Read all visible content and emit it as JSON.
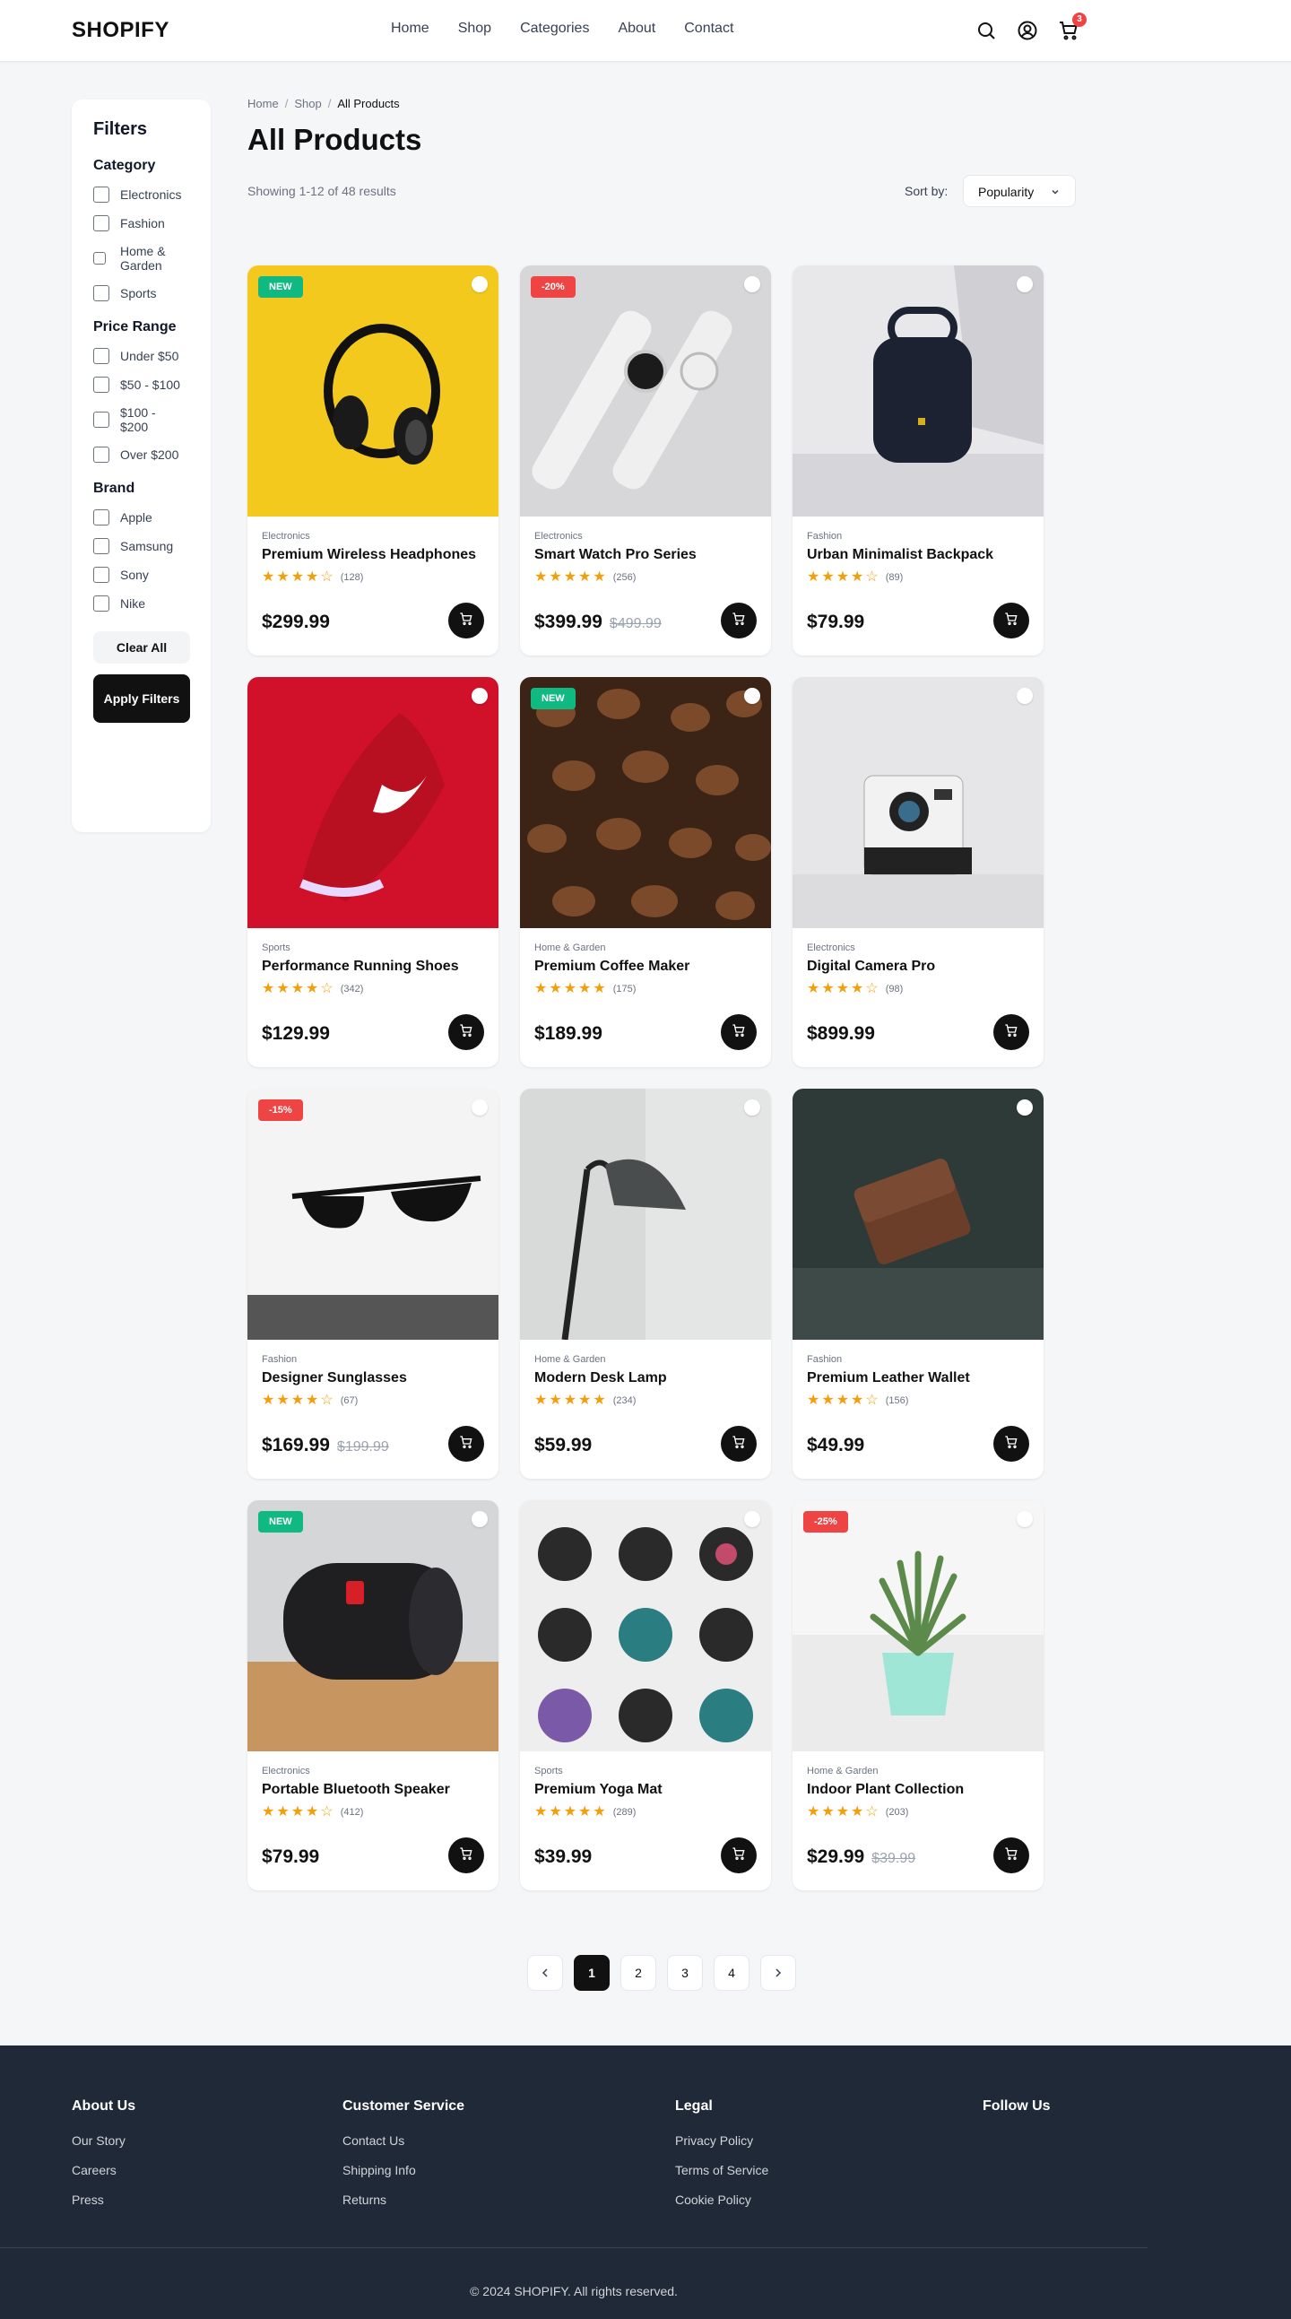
{
  "header": {
    "logo": "SHOPIFY",
    "nav": [
      "Home",
      "Shop",
      "Categories",
      "About",
      "Contact"
    ],
    "cart_count": "3"
  },
  "sidebar": {
    "title": "Filters",
    "category": {
      "title": "Category",
      "items": [
        "Electronics",
        "Fashion",
        "Home & Garden",
        "Sports"
      ]
    },
    "price": {
      "title": "Price Range",
      "items": [
        "Under $50",
        "$50 - $100",
        "$100 - $200",
        "Over $200"
      ]
    },
    "brand": {
      "title": "Brand",
      "items": [
        "Apple",
        "Samsung",
        "Sony",
        "Nike"
      ]
    },
    "clear_label": "Clear All",
    "apply_label": "Apply Filters"
  },
  "main": {
    "breadcrumb": [
      "Home",
      "Shop",
      "All Products"
    ],
    "title": "All Products",
    "results": "Showing 1-12 of 48 results",
    "sort_label": "Sort by:",
    "sort_value": "Popularity"
  },
  "products": [
    {
      "category": "Electronics",
      "name": "Premium Wireless Headphones",
      "rating": 4,
      "reviews": "(128)",
      "price": "$299.99",
      "old_price": "",
      "badge": "NEW"
    },
    {
      "category": "Electronics",
      "name": "Smart Watch Pro Series",
      "rating": 5,
      "reviews": "(256)",
      "price": "$399.99",
      "old_price": "$499.99",
      "badge": "-20%"
    },
    {
      "category": "Fashion",
      "name": "Urban Minimalist Backpack",
      "rating": 4,
      "reviews": "(89)",
      "price": "$79.99",
      "old_price": "",
      "badge": ""
    },
    {
      "category": "Sports",
      "name": "Performance Running Shoes",
      "rating": 4,
      "reviews": "(342)",
      "price": "$129.99",
      "old_price": "",
      "badge": ""
    },
    {
      "category": "Home & Garden",
      "name": "Premium Coffee Maker",
      "rating": 5,
      "reviews": "(175)",
      "price": "$189.99",
      "old_price": "",
      "badge": "NEW"
    },
    {
      "category": "Electronics",
      "name": "Digital Camera Pro",
      "rating": 4,
      "reviews": "(98)",
      "price": "$899.99",
      "old_price": "",
      "badge": ""
    },
    {
      "category": "Fashion",
      "name": "Designer Sunglasses",
      "rating": 4,
      "reviews": "(67)",
      "price": "$169.99",
      "old_price": "$199.99",
      "badge": "-15%"
    },
    {
      "category": "Home & Garden",
      "name": "Modern Desk Lamp",
      "rating": 5,
      "reviews": "(234)",
      "price": "$59.99",
      "old_price": "",
      "badge": ""
    },
    {
      "category": "Fashion",
      "name": "Premium Leather Wallet",
      "rating": 4,
      "reviews": "(156)",
      "price": "$49.99",
      "old_price": "",
      "badge": ""
    },
    {
      "category": "Electronics",
      "name": "Portable Bluetooth Speaker",
      "rating": 4,
      "reviews": "(412)",
      "price": "$79.99",
      "old_price": "",
      "badge": "NEW"
    },
    {
      "category": "Sports",
      "name": "Premium Yoga Mat",
      "rating": 5,
      "reviews": "(289)",
      "price": "$39.99",
      "old_price": "",
      "badge": ""
    },
    {
      "category": "Home & Garden",
      "name": "Indoor Plant Collection",
      "rating": 4,
      "reviews": "(203)",
      "price": "$29.99",
      "old_price": "$39.99",
      "badge": "-25%"
    }
  ],
  "pagination": {
    "pages": [
      "1",
      "2",
      "3",
      "4"
    ],
    "active": "1"
  },
  "footer": {
    "about": {
      "title": "About Us",
      "links": [
        "Our Story",
        "Careers",
        "Press"
      ]
    },
    "service": {
      "title": "Customer Service",
      "links": [
        "Contact Us",
        "Shipping Info",
        "Returns"
      ]
    },
    "legal": {
      "title": "Legal",
      "links": [
        "Privacy Policy",
        "Terms of Service",
        "Cookie Policy"
      ]
    },
    "follow": {
      "title": "Follow Us"
    },
    "copyright": "© 2024 SHOPIFY. All rights reserved."
  }
}
